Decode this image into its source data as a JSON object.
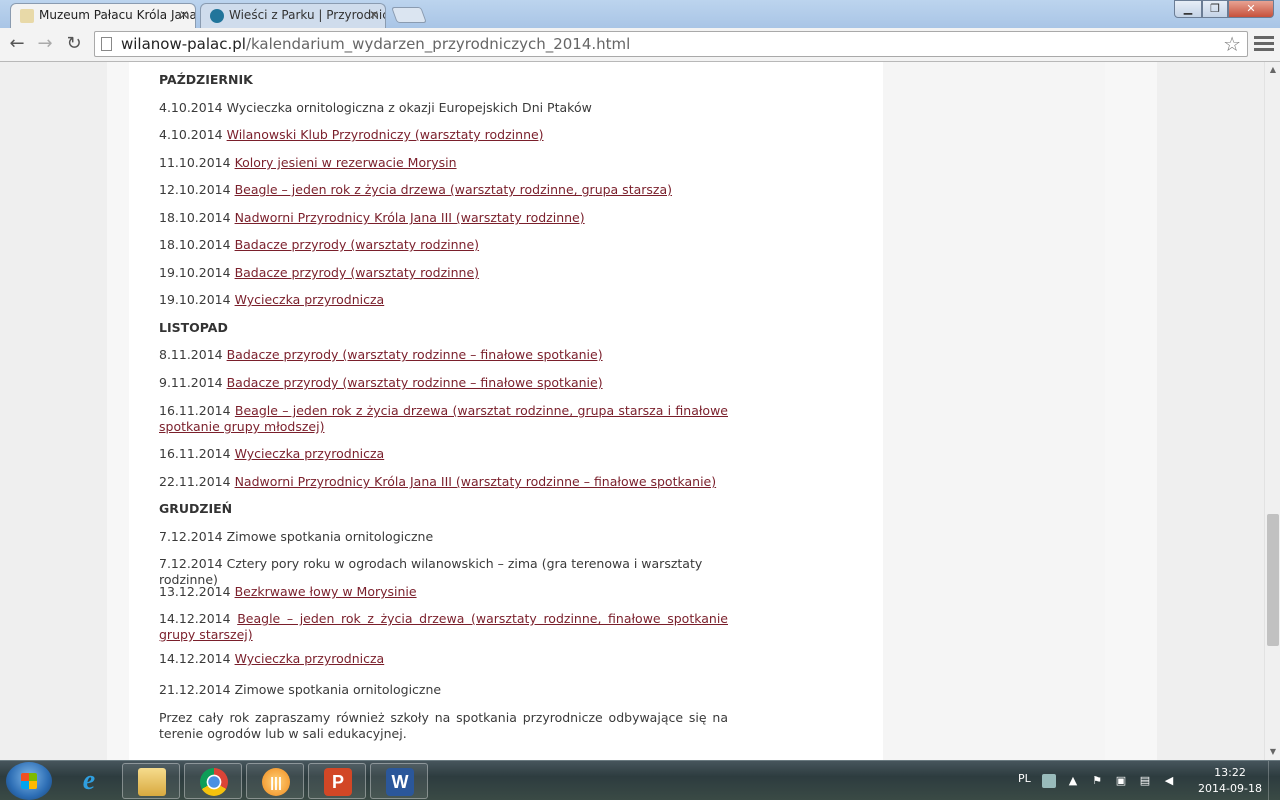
{
  "browser": {
    "tabs": [
      {
        "title": "Muzeum Pałacu Króla Jana"
      },
      {
        "title": "Wieści z Parku | Przyrodnic"
      }
    ],
    "url": {
      "domain": "wilanow-palac.pl",
      "path": "/kalendarium_wydarzen_przyrodniczych_2014.html"
    }
  },
  "article": {
    "rows": [
      {
        "type": "month",
        "text": "PAŹDZIERNIK"
      },
      {
        "type": "event",
        "date": "4.10.2014",
        "text": "Wycieczka ornitologiczna z okazji Europejskich Dni Ptaków",
        "link": false
      },
      {
        "type": "event",
        "date": "4.10.2014",
        "text": "Wilanowski Klub Przyrodniczy (warsztaty rodzinne)",
        "link": true
      },
      {
        "type": "event",
        "date": "11.10.2014",
        "text": "Kolory jesieni w rezerwacie Morysin",
        "link": true
      },
      {
        "type": "event",
        "date": "12.10.2014",
        "text": "Beagle – jeden rok z życia drzewa (warsztaty rodzinne, grupa starsza)",
        "link": true
      },
      {
        "type": "event",
        "date": "18.10.2014",
        "text": "Nadworni Przyrodnicy Króla Jana III (warsztaty rodzinne)",
        "link": true
      },
      {
        "type": "event",
        "date": "18.10.2014",
        "text": "Badacze przyrody (warsztaty rodzinne)",
        "link": true
      },
      {
        "type": "event",
        "date": "19.10.2014",
        "text": "Badacze przyrody (warsztaty rodzinne)",
        "link": true
      },
      {
        "type": "event",
        "date": "19.10.2014",
        "text": "Wycieczka przyrodnicza",
        "link": true
      },
      {
        "type": "month",
        "text": "LISTOPAD"
      },
      {
        "type": "event",
        "date": "8.11.2014",
        "text": "Badacze przyrody (warsztaty rodzinne – finałowe spotkanie)",
        "link": true
      },
      {
        "type": "event",
        "date": "9.11.2014",
        "text": "Badacze przyrody (warsztaty rodzinne – finałowe spotkanie)",
        "link": true
      },
      {
        "type": "event",
        "date": "16.11.2014",
        "text": "Beagle – jeden rok z życia drzewa (warsztat rodzinne, grupa starsza i finałowe spotkanie grupy młodszej)",
        "link": true
      },
      {
        "type": "event",
        "date": "16.11.2014",
        "text": "Wycieczka przyrodnicza",
        "link": true
      },
      {
        "type": "event",
        "date": "22.11.2014",
        "text": "Nadworni Przyrodnicy Króla Jana III (warsztaty rodzinne – finałowe spotkanie)",
        "link": true
      },
      {
        "type": "month",
        "text": "GRUDZIEŃ"
      },
      {
        "type": "event",
        "date": "7.12.2014",
        "text": "Zimowe spotkania ornitologiczne",
        "link": false
      },
      {
        "type": "event",
        "date": "7.12.2014",
        "text": "Cztery pory roku w ogrodach wilanowskich – zima (gra terenowa i warsztaty rodzinne)",
        "link": false
      },
      {
        "type": "event",
        "date": "13.12.2014",
        "text": "Bezkrwawe łowy w Morysinie",
        "link": true
      },
      {
        "type": "event",
        "date": "14.12.2014",
        "text": "Beagle – jeden rok z życia drzewa (warsztaty rodzinne, finałowe spotkanie grupy starszej)",
        "link": true
      },
      {
        "type": "event",
        "date": "14.12.2014",
        "text": "Wycieczka przyrodnicza",
        "link": true
      },
      {
        "type": "event",
        "date": "21.12.2014",
        "text": "Zimowe spotkania ornitologiczne",
        "link": false
      },
      {
        "type": "para",
        "text": "Przez cały rok zapraszamy również szkoły na spotkania przyrodnicze odbywające się na terenie ogrodów lub w sali edukacyjnej."
      }
    ]
  },
  "taskbar": {
    "language": "PL",
    "time": "13:22",
    "date": "2014-09-18",
    "apps": [
      "internet-explorer",
      "file-explorer",
      "chrome",
      "app",
      "powerpoint",
      "word"
    ]
  },
  "colors": {
    "link": "#7a1f2b",
    "text": "#3a3a3a"
  }
}
